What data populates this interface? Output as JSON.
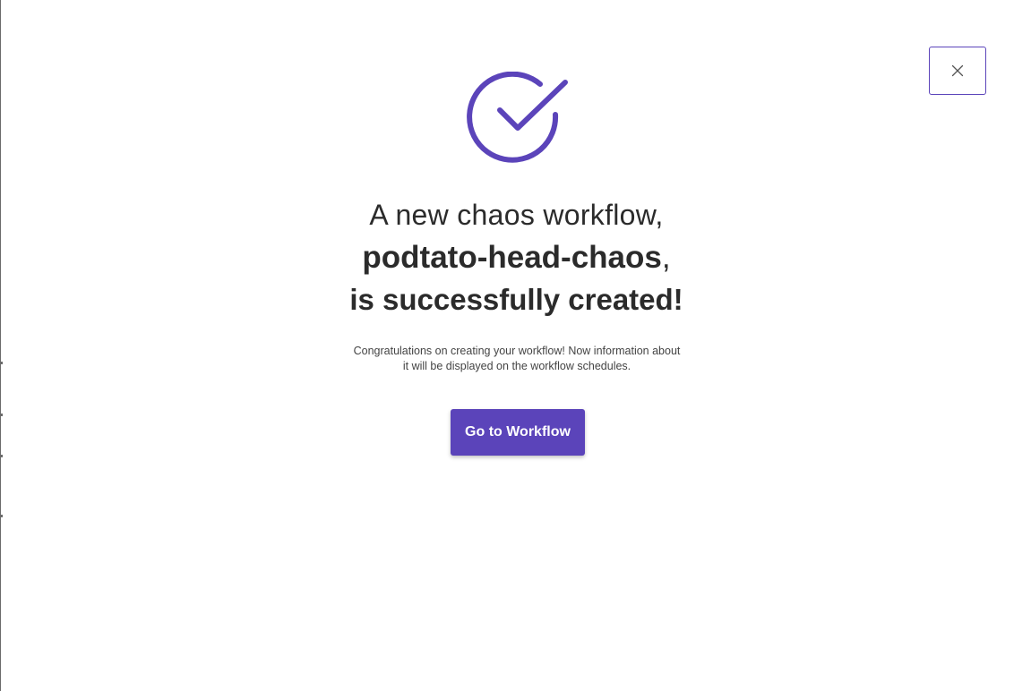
{
  "modal": {
    "close_icon": "close-icon",
    "success_icon": "check-circle-icon",
    "title_line1": "A new chaos workflow,",
    "workflow_name": "podtato-head-chaos",
    "comma": ",",
    "title_line3": "is successfully created!",
    "description_line1": "Congratulations on creating your workflow! Now information about",
    "description_line2": "it will be displayed on the workflow schedules.",
    "primary_button_label": "Go to Workflow"
  },
  "colors": {
    "accent": "#5b44ba",
    "text_primary": "#2b2b2b",
    "text_secondary": "#444444",
    "background": "#ffffff"
  }
}
